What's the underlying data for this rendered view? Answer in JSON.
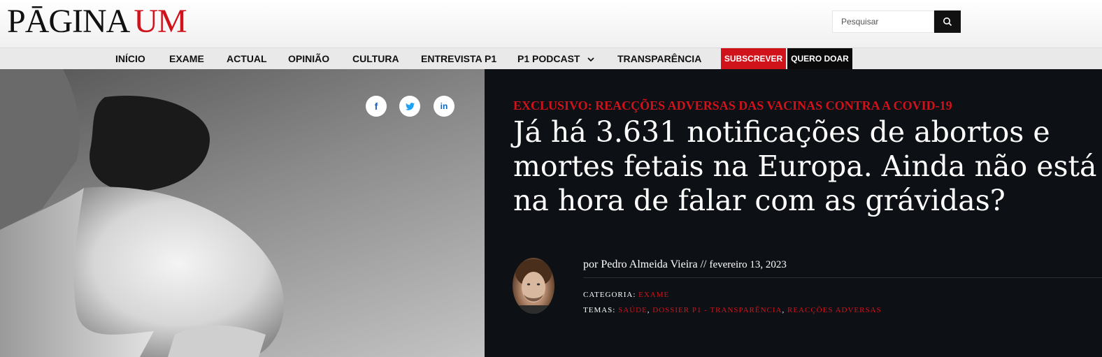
{
  "logo": {
    "part1": "PĀGINA",
    "part2": "UM"
  },
  "search": {
    "placeholder": "Pesquisar",
    "icon": "search-icon"
  },
  "nav": {
    "items": [
      "INÍCIO",
      "EXAME",
      "ACTUAL",
      "OPINIÃO",
      "CULTURA",
      "ENTREVISTA P1",
      "P1 PODCAST",
      "TRANSPARÊNCIA"
    ],
    "subscribe": "SUBSCREVER",
    "donate": "QUERO DOAR"
  },
  "share": {
    "facebook": "f",
    "twitter": "twitter-icon",
    "linkedin": "in"
  },
  "article": {
    "kicker": "EXCLUSIVO: REACÇÕES ADVERSAS DAS VACINAS CONTRA A COVID-19",
    "title": "Já há 3.631 notificações de abortos e mortes fetais na Europa. Ainda não está na hora de falar com as grávidas?",
    "byline_prefix": "por",
    "author": "Pedro Almeida Vieira",
    "separator": "//",
    "date": "fevereiro 13, 2023",
    "category_label": "CATEGORIA:",
    "category": "EXAME",
    "tags_label": "TEMAS:",
    "tags": [
      "SAÚDE",
      "DOSSIER P1 - TRANSPARÊNCIA",
      "REACÇÕES ADVERSAS"
    ]
  },
  "colors": {
    "brand_red": "#d0121b",
    "panel_bg": "#0d1115"
  }
}
